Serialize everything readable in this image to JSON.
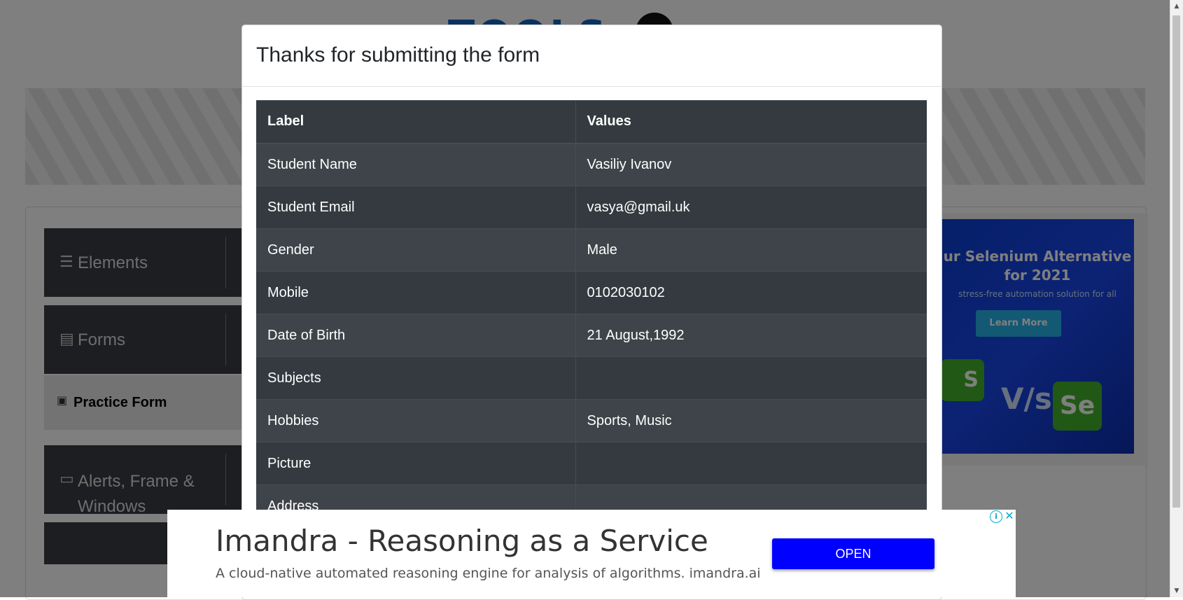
{
  "background": {
    "logo_text": "TOOLS",
    "sidebar": {
      "elements_label": "Elements",
      "forms_label": "Forms",
      "practice_form_label": "Practice Form",
      "alerts_label": "Alerts, Frame & Windows"
    },
    "side_ad": {
      "title": "ur Selenium Alternative for 2021",
      "subtitle": "stress-free automation solution for all",
      "button": "Learn More",
      "vs": "V/s",
      "se": "Se",
      "s": "S"
    }
  },
  "modal": {
    "title": "Thanks for submitting the form",
    "table": {
      "headers": [
        "Label",
        "Values"
      ],
      "rows": [
        {
          "label": "Student Name",
          "value": "Vasiliy Ivanov"
        },
        {
          "label": "Student Email",
          "value": "vasya@gmail.uk"
        },
        {
          "label": "Gender",
          "value": "Male"
        },
        {
          "label": "Mobile",
          "value": "0102030102"
        },
        {
          "label": "Date of Birth",
          "value": "21 August,1992"
        },
        {
          "label": "Subjects",
          "value": ""
        },
        {
          "label": "Hobbies",
          "value": "Sports, Music"
        },
        {
          "label": "Picture",
          "value": ""
        },
        {
          "label": "Address",
          "value": ""
        }
      ]
    }
  },
  "bottom_ad": {
    "title": "Imandra - Reasoning as a Service",
    "description": "A cloud-native automated reasoning engine for analysis of algorithms. imandra.ai",
    "open_button": "OPEN",
    "info_icon": "i",
    "close_icon": "✕"
  },
  "icons": {
    "menu": "hamburger-icon",
    "forms": "document-icon",
    "practice": "badge-icon",
    "alerts": "window-icon"
  }
}
